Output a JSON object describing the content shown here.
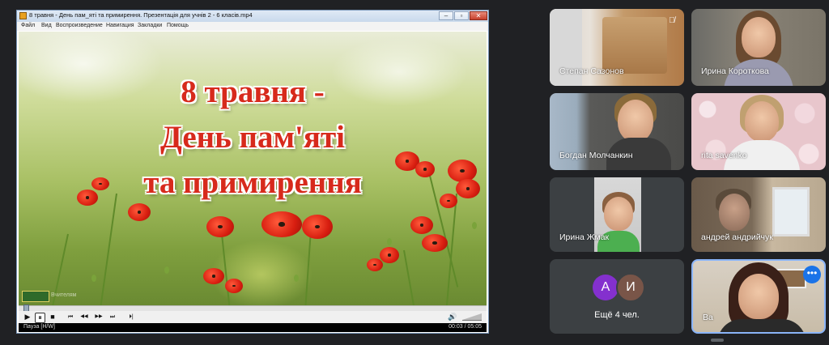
{
  "player": {
    "title": "8 травня - День пам_яті та примирення. Презентація для учнів 2 - 6 класів.mp4",
    "menu": [
      "Файл",
      "Вид",
      "Воспроизведение",
      "Навигация",
      "Закладки",
      "Помощь"
    ],
    "video_title_lines": [
      "8 травня -",
      "День пам'яті",
      "та примирення"
    ],
    "watermark": "Вчителям",
    "status": {
      "state": "Пауза [H/W]",
      "time": "00:03 / 05:05"
    },
    "progress_fraction": 0.01,
    "controls": {
      "play": "▶",
      "pause": "⏸",
      "stop": "■",
      "prev": "⏮",
      "rewind": "◀◀",
      "forward": "▶▶",
      "next": "⏭",
      "frame": "⏵|",
      "volume": "🔊"
    }
  },
  "participants": [
    {
      "name": "Степан Сазонов",
      "muted": true
    },
    {
      "name": "Ирина Короткова"
    },
    {
      "name": "Богдан Молчанкин"
    },
    {
      "name": "rita savenko"
    },
    {
      "name": "Ирина Жмак"
    },
    {
      "name": "андрей андрийчук"
    }
  ],
  "more": {
    "avatars": [
      {
        "letter": "А",
        "color": "#8430ce"
      },
      {
        "letter": "И",
        "color": "#795548"
      }
    ],
    "label": "Ещё 4 чел."
  },
  "self_tile": {
    "name": "Ва",
    "menu_icon": "•••"
  }
}
